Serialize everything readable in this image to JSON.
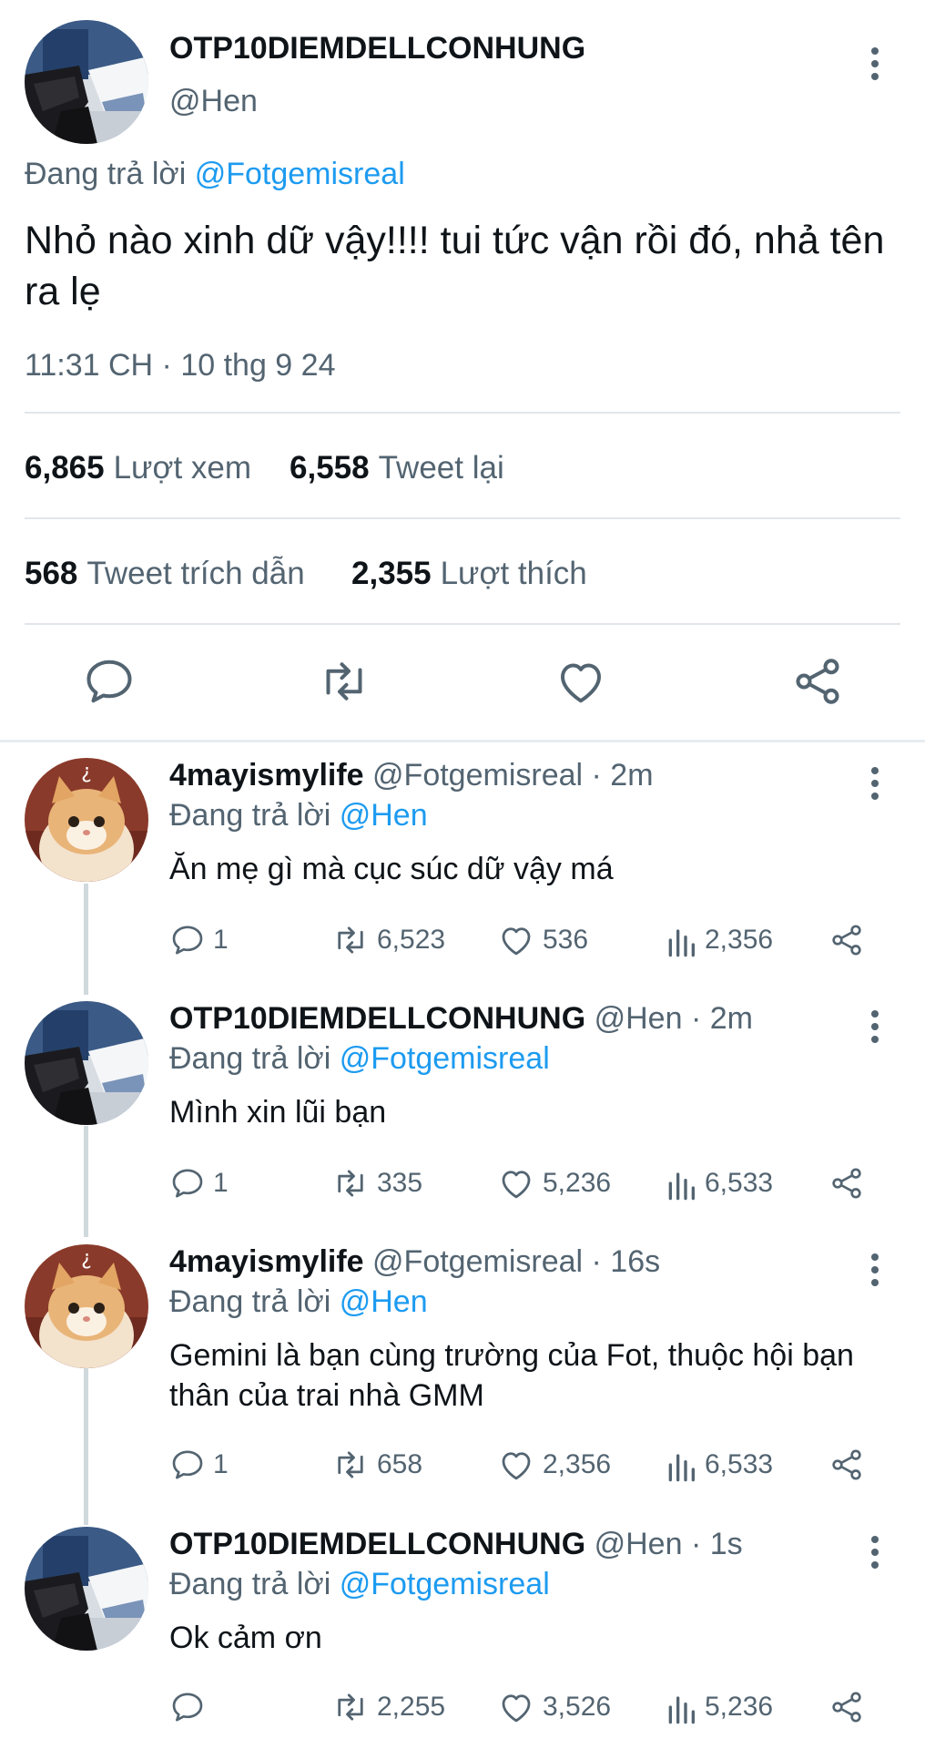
{
  "tweet": {
    "author_name": "OTP10DIEMDELLCONHUNG",
    "author_handle": "@Hen",
    "reply_prefix": "Đang trả lời",
    "reply_to": "@Fotgemisreal",
    "text": "Nhỏ nào xinh dữ vậy!!!! tui tức vận rồi đó, nhả tên ra lẹ",
    "timestamp": "11:31 CH · 10 thg 9 24",
    "stats": {
      "views_value": "6,865",
      "views_label": "Lượt xem",
      "retweets_value": "6,558",
      "retweets_label": "Tweet lại",
      "quotes_value": "568",
      "quotes_label": "Tweet trích dẫn",
      "likes_value": "2,355",
      "likes_label": "Lượt thích"
    },
    "actions": [
      "reply-icon",
      "retweet-icon",
      "like-icon",
      "share-icon"
    ]
  },
  "replies": [
    {
      "name": "4mayismylife",
      "handle": "@Fotgemisreal",
      "time": "· 2m",
      "reply_prefix": "Đang trả lời",
      "reply_to": "@Hen",
      "text": "Ăn mẹ gì mà cục súc dữ vậy má",
      "replies": "1",
      "retweets": "6,523",
      "likes": "536",
      "views": "2,356",
      "avatar": "cat-avatar"
    },
    {
      "name": "OTP10DIEMDELLCONHUNG",
      "handle": "@Hen",
      "time": "· 2m",
      "reply_prefix": "Đang trả lời",
      "reply_to": "@Fotgemisreal",
      "text": "Mình xin lũi bạn",
      "replies": "1",
      "retweets": "335",
      "likes": "5,236",
      "views": "6,533",
      "avatar": "shoes-avatar"
    },
    {
      "name": "4mayismylife",
      "handle": "@Fotgemisreal",
      "time": "· 16s",
      "reply_prefix": "Đang trả lời",
      "reply_to": "@Hen",
      "text": "Gemini là bạn cùng trường của Fot, thuộc hội bạn thân của trai nhà GMM",
      "replies": "1",
      "retweets": "658",
      "likes": "2,356",
      "views": "6,533",
      "avatar": "cat-avatar"
    },
    {
      "name": "OTP10DIEMDELLCONHUNG",
      "handle": "@Hen",
      "time": "· 1s",
      "reply_prefix": "Đang trả lời",
      "reply_to": "@Fotgemisreal",
      "text": "Ok cảm ơn",
      "replies": "",
      "retweets": "2,255",
      "likes": "3,526",
      "views": "5,236",
      "avatar": "shoes-avatar"
    }
  ],
  "colors": {
    "link": "#1d9bf0",
    "muted": "#536471",
    "text": "#0f1419"
  }
}
